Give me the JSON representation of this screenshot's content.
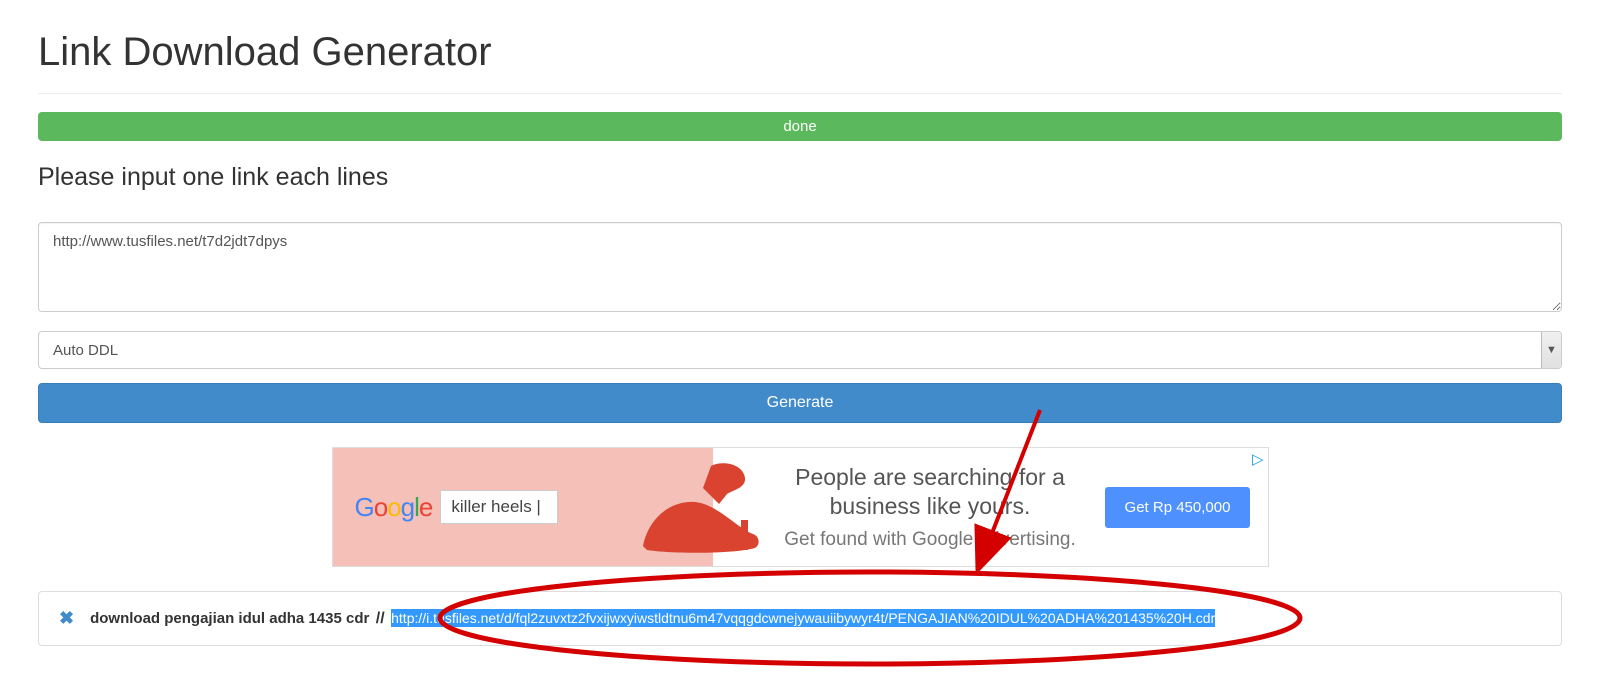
{
  "page": {
    "title": "Link Download Generator"
  },
  "status": {
    "text": "done"
  },
  "form": {
    "label": "Please input one link each lines",
    "textarea_value": "http://www.tusfiles.net/t7d2jdt7dpys",
    "select_value": "Auto DDL",
    "button_label": "Generate"
  },
  "ad": {
    "logo_letters": [
      "G",
      "o",
      "o",
      "g",
      "l",
      "e"
    ],
    "search_text": "killer heels |",
    "headline_line1": "People are searching for a",
    "headline_line2": "business like yours.",
    "subline": "Get found with Google advertising.",
    "cta": "Get Rp 450,000",
    "adchoices_glyph": "▷"
  },
  "result": {
    "close_glyph": "✖",
    "label": "download pengajian idul adha 1435 cdr",
    "separator": "//",
    "url": "http://i.tusfiles.net/d/fql2zuvxtz2fvxijwxyiwstldtnu6m47vqqgdcwnejywauiibywyr4t/PENGAJIAN%20IDUL%20ADHA%201435%20H.cdr"
  },
  "colors": {
    "success": "#5cb85c",
    "primary": "#428bca",
    "highlight_bg": "#3399ff",
    "annotation": "#d40000"
  }
}
